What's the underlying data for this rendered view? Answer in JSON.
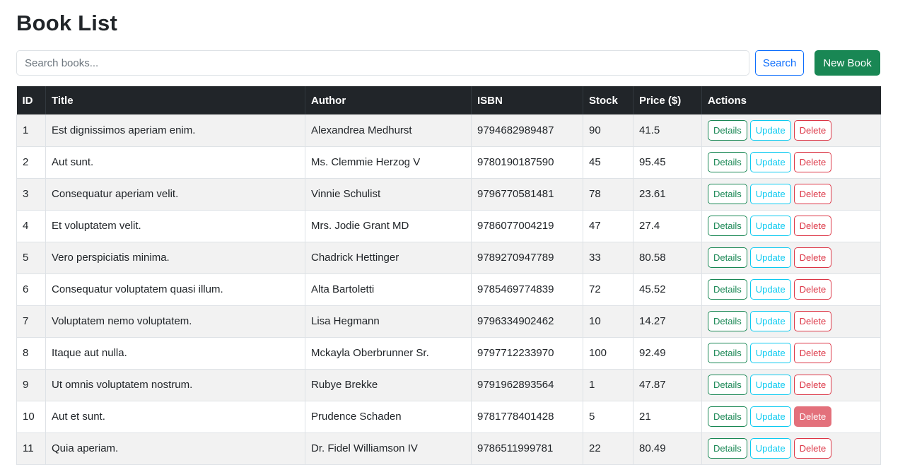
{
  "page": {
    "title": "Book List"
  },
  "search": {
    "placeholder": "Search books...",
    "value": "",
    "button_label": "Search"
  },
  "new_book": {
    "label": "New Book"
  },
  "table": {
    "headers": [
      "ID",
      "Title",
      "Author",
      "ISBN",
      "Stock",
      "Price ($)",
      "Actions"
    ],
    "rows": [
      {
        "id": "1",
        "title": "Est dignissimos aperiam enim.",
        "author": "Alexandrea Medhurst",
        "isbn": "9794682989487",
        "stock": "90",
        "price": "41.5"
      },
      {
        "id": "2",
        "title": "Aut sunt.",
        "author": "Ms. Clemmie Herzog V",
        "isbn": "9780190187590",
        "stock": "45",
        "price": "95.45"
      },
      {
        "id": "3",
        "title": "Consequatur aperiam velit.",
        "author": "Vinnie Schulist",
        "isbn": "9796770581481",
        "stock": "78",
        "price": "23.61"
      },
      {
        "id": "4",
        "title": "Et voluptatem velit.",
        "author": "Mrs. Jodie Grant MD",
        "isbn": "9786077004219",
        "stock": "47",
        "price": "27.4"
      },
      {
        "id": "5",
        "title": "Vero perspiciatis minima.",
        "author": "Chadrick Hettinger",
        "isbn": "9789270947789",
        "stock": "33",
        "price": "80.58"
      },
      {
        "id": "6",
        "title": "Consequatur voluptatem quasi illum.",
        "author": "Alta Bartoletti",
        "isbn": "9785469774839",
        "stock": "72",
        "price": "45.52"
      },
      {
        "id": "7",
        "title": "Voluptatem nemo voluptatem.",
        "author": "Lisa Hegmann",
        "isbn": "9796334902462",
        "stock": "10",
        "price": "14.27"
      },
      {
        "id": "8",
        "title": "Itaque aut nulla.",
        "author": "Mckayla Oberbrunner Sr.",
        "isbn": "9797712233970",
        "stock": "100",
        "price": "92.49"
      },
      {
        "id": "9",
        "title": "Ut omnis voluptatem nostrum.",
        "author": "Rubye Brekke",
        "isbn": "9791962893564",
        "stock": "1",
        "price": "47.87"
      },
      {
        "id": "10",
        "title": "Aut et sunt.",
        "author": "Prudence Schaden",
        "isbn": "9781778401428",
        "stock": "5",
        "price": "21"
      },
      {
        "id": "11",
        "title": "Quia aperiam.",
        "author": "Dr. Fidel Williamson IV",
        "isbn": "9786511999781",
        "stock": "22",
        "price": "80.49"
      }
    ],
    "actions": {
      "details": "Details",
      "update": "Update",
      "delete": "Delete"
    }
  },
  "colors": {
    "header_bg": "#212529",
    "success": "#198754",
    "info": "#0dcaf0",
    "danger": "#dc3545",
    "primary": "#0d6efd",
    "stripe": "#f2f2f2"
  }
}
